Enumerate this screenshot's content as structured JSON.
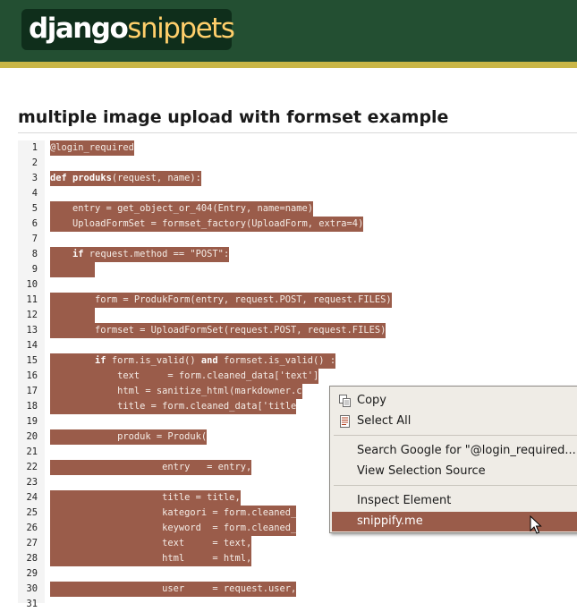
{
  "header": {
    "logo_word_1": "django",
    "logo_word_2": "snippets",
    "bar_color": "#234f32",
    "stripe_color": "#c9b646"
  },
  "page": {
    "title": "multiple image upload with formset example"
  },
  "code": {
    "selection_color": "#9a5c4a",
    "lines": [
      {
        "n": "1",
        "segs": [
          {
            "t": "@login_required"
          }
        ]
      },
      {
        "n": "2",
        "segs": []
      },
      {
        "n": "3",
        "segs": [
          {
            "t": "def",
            "kw": true
          },
          {
            "t": " "
          },
          {
            "t": "produks",
            "kw": true
          },
          {
            "t": "(request, name):"
          }
        ]
      },
      {
        "n": "4",
        "segs": []
      },
      {
        "n": "5",
        "segs": [
          {
            "t": "    entry = get_object_or_404(Entry, name=name)"
          }
        ]
      },
      {
        "n": "6",
        "segs": [
          {
            "t": "    UploadFormSet = formset_factory(UploadForm, extra=4)"
          }
        ]
      },
      {
        "n": "7",
        "segs": []
      },
      {
        "n": "8",
        "segs": [
          {
            "t": "    "
          },
          {
            "t": "if",
            "kw": true
          },
          {
            "t": " request.method == \"POST\":"
          }
        ]
      },
      {
        "n": "9",
        "segs": [
          {
            "t": "        "
          }
        ]
      },
      {
        "n": "10",
        "segs": []
      },
      {
        "n": "11",
        "segs": [
          {
            "t": "        form = ProdukForm(entry, request.POST, request.FILES)"
          }
        ]
      },
      {
        "n": "12",
        "segs": [
          {
            "t": "        "
          }
        ]
      },
      {
        "n": "13",
        "segs": [
          {
            "t": "        formset = UploadFormSet(request.POST, request.FILES)"
          }
        ]
      },
      {
        "n": "14",
        "segs": []
      },
      {
        "n": "15",
        "segs": [
          {
            "t": "        "
          },
          {
            "t": "if",
            "kw": true
          },
          {
            "t": " form.is_valid() "
          },
          {
            "t": "and",
            "kw": true
          },
          {
            "t": " formset.is_valid() :"
          }
        ]
      },
      {
        "n": "16",
        "segs": [
          {
            "t": "            text     = form.cleaned_data['text']"
          }
        ]
      },
      {
        "n": "17",
        "segs": [
          {
            "t": "            html = sanitize_html(markdowner.c"
          }
        ]
      },
      {
        "n": "18",
        "segs": [
          {
            "t": "            title = form.cleaned_data['title"
          }
        ]
      },
      {
        "n": "19",
        "segs": []
      },
      {
        "n": "20",
        "segs": [
          {
            "t": "            produk = Produk("
          }
        ]
      },
      {
        "n": "21",
        "segs": []
      },
      {
        "n": "22",
        "segs": [
          {
            "t": "                    entry   = entry,"
          }
        ]
      },
      {
        "n": "23",
        "segs": []
      },
      {
        "n": "24",
        "segs": [
          {
            "t": "                    title = title,"
          }
        ]
      },
      {
        "n": "25",
        "segs": [
          {
            "t": "                    kategori = form.cleaned_"
          }
        ]
      },
      {
        "n": "26",
        "segs": [
          {
            "t": "                    keyword  = form.cleaned_"
          }
        ]
      },
      {
        "n": "27",
        "segs": [
          {
            "t": "                    text     = text,"
          }
        ]
      },
      {
        "n": "28",
        "segs": [
          {
            "t": "                    html     = html,"
          }
        ]
      },
      {
        "n": "29",
        "segs": []
      },
      {
        "n": "30",
        "segs": [
          {
            "t": "                    user     = request.user,"
          }
        ]
      },
      {
        "n": "31",
        "segs": []
      }
    ]
  },
  "context_menu": {
    "items": [
      {
        "id": "copy",
        "label": "Copy",
        "icon": "copy-icon"
      },
      {
        "id": "select-all",
        "label": "Select All",
        "icon": "select-all-icon"
      },
      {
        "id": "search-google",
        "label": "Search Google for \"@login_required...\""
      },
      {
        "id": "view-selection-source",
        "label": "View Selection Source"
      },
      {
        "id": "inspect-element",
        "label": "Inspect Element"
      },
      {
        "id": "snippify",
        "label": "snippify.me",
        "highlighted": true
      }
    ],
    "highlight_color": "#9a5c4a"
  }
}
